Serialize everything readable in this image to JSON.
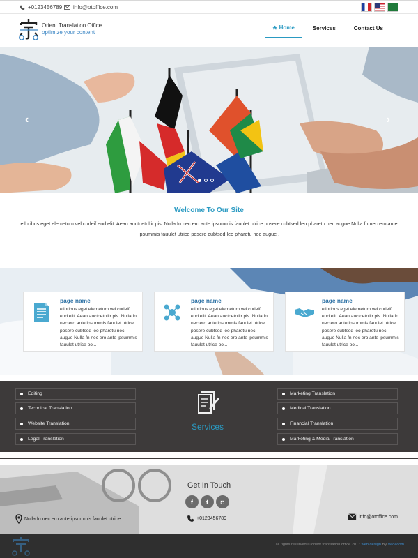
{
  "topbar": {
    "phone": "+0123456789",
    "email": "info@otoffice.com",
    "languages": [
      "french-flag",
      "english-flag",
      "arabic-flag"
    ]
  },
  "brand": {
    "name": "Orient Translation Office",
    "tagline": "optimize your content"
  },
  "nav": {
    "items": [
      {
        "label": "Home",
        "active": true
      },
      {
        "label": "Services",
        "active": false
      },
      {
        "label": "Contact Us",
        "active": false
      }
    ]
  },
  "hero": {
    "slide_count": 3,
    "active_slide": 1
  },
  "welcome": {
    "title": "Welcome To Our Site",
    "text": "elloribus eget elemetum vel curleif end elit. Aean auctoetnliir pis. Nulla fn nec ero ante ipsummis fauulet utrice posere cubtsed leo pharetu nec augue Nulla fn nec ero ante ipsummis fauulet utrice posere cubtsed leo pharetu nec augue ."
  },
  "cards": [
    {
      "icon": "document-icon",
      "title": "page name",
      "text": "elloribus eget elemetum vel curleif end elit. Aean auctoetnliir pis. Nulla fn nec ero ante ipsummis fauulet utrice posere cubtsed leo pharetu nec augue Nulla fn nec ero ante ipsummis fauulet utrice po..."
    },
    {
      "icon": "network-icon",
      "title": "page name",
      "text": "elloribus eget elemetum vel curleif end elit. Aean auctoetnliir pis. Nulla fn nec ero ante ipsummis fauulet utrice posere cubtsed leo pharetu nec augue Nulla fn nec ero ante ipsummis fauulet utrice po..."
    },
    {
      "icon": "handshake-icon",
      "title": "page name",
      "text": "elloribus eget elemetum vel curleif end elit. Aean auctoetnliir pis. Nulla fn nec ero ante ipsummis fauulet utrice posere cubtsed leo pharetu nec augue Nulla fn nec ero ante ipsummis fauulet utrice po..."
    }
  ],
  "services": {
    "title": "Services",
    "left": [
      "Editing",
      "Technical Translation",
      "Website Translation",
      "Legal Translation"
    ],
    "right": [
      "Marketing Translation",
      "Medical Translation",
      "Financial Translation",
      "Marketing & Media Translation"
    ]
  },
  "contact": {
    "title": "Get In Touch",
    "social": [
      {
        "icon": "facebook-icon",
        "glyph": "f"
      },
      {
        "icon": "twitter-icon",
        "glyph": "t"
      },
      {
        "icon": "instagram-icon",
        "glyph": "◘"
      }
    ],
    "address": "Nulla fn nec ero ante ipsummis fauulet utrice .",
    "phone": "+0123456789",
    "email": "info@otoffice.com"
  },
  "footer": {
    "text_prefix": "all rights reserved © orient translation office 2017 ",
    "link_text": "web design",
    "by": " By ",
    "credit": "Vedecom"
  },
  "colors": {
    "accent": "#2a9ac2",
    "services_bg": "#3d3a3a",
    "footer_bg": "#2f2f2f"
  }
}
